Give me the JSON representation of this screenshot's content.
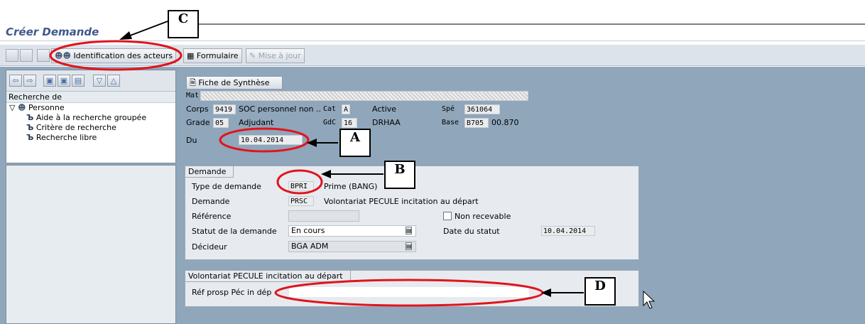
{
  "window": {
    "title": "Créer Demande"
  },
  "toolbar": {
    "btn_acteurs": "Identification des acteurs",
    "btn_formulaire": "Formulaire",
    "btn_maj": "Mise à jour"
  },
  "tree": {
    "header": "Recherche de",
    "root": "Personne",
    "items": [
      "Aide à la recherche groupée",
      "Critère de recherche",
      "Recherche libre"
    ]
  },
  "summary": {
    "fiche_btn": "Fiche de Synthèse",
    "mat_label": "Mat",
    "corps_label": "Corps",
    "corps_code": "9419",
    "corps_text": "SOC personnel non ..",
    "cat_label": "Cat",
    "cat_value": "A",
    "status": "Active",
    "spe_label": "Spé",
    "spe_value": "361064",
    "grade_label": "Grade",
    "grade_code": "05",
    "grade_text": "Adjudant",
    "gdc_label": "GdC",
    "gdc_value": "16",
    "unit": "DRHAA",
    "base_label": "Base",
    "base_value": "B705",
    "base_num": "00.870",
    "du_label": "Du",
    "du_value": "10.04.2014"
  },
  "demande": {
    "group_title": "Demande",
    "type_label": "Type de demande",
    "type_code": "BPRI",
    "type_text": "Prime (BANG)",
    "demande_label": "Demande",
    "demande_code": "PRSC",
    "demande_text": "Volontariat PECULE incitation au départ",
    "reference_label": "Référence",
    "reference_value": "",
    "non_recevable_label": "Non recevable",
    "statut_label": "Statut de la demande",
    "statut_value": "En cours",
    "date_statut_label": "Date du statut",
    "date_statut_value": "10.04.2014",
    "decideur_label": "Décideur",
    "decideur_value": "BGA ADM"
  },
  "volontariat": {
    "group_title": "Volontariat PECULE incitation au départ",
    "ref_label": "Réf prosp Péc in dép",
    "ref_value": ""
  },
  "callouts": {
    "a": "A",
    "b": "B",
    "c": "C",
    "d": "D"
  },
  "colors": {
    "annotation_red": "#e0141e",
    "title_blue": "#3f5a8a",
    "workspace": "#8fa6bb"
  }
}
